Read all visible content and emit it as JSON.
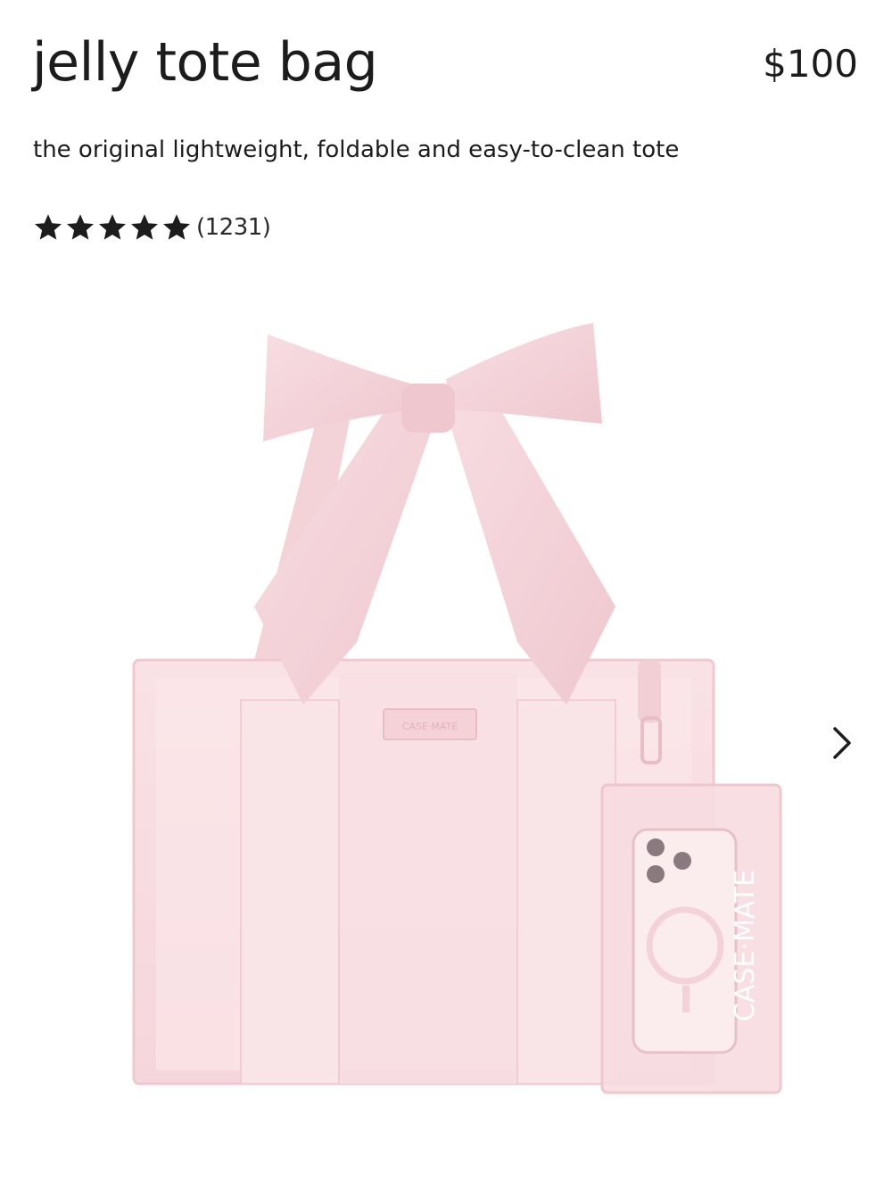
{
  "product": {
    "title": "jelly tote bag",
    "price": "$100",
    "subtitle": "the original lightweight, foldable and easy-to-clean tote",
    "rating": {
      "stars": 5,
      "max_stars": 5,
      "review_count": "(1231)"
    },
    "image": {
      "bag_label": "CASE·MATE",
      "pouch_label": "CASE·MATE"
    }
  },
  "colors": {
    "text": "#1c1c1c",
    "bag_pink": "#f6d9df",
    "bow_pink": "#f4d3d9",
    "strap_pink": "#f8e2e6"
  },
  "icons": {
    "next": "chevron-right-icon",
    "star": "star-icon"
  }
}
